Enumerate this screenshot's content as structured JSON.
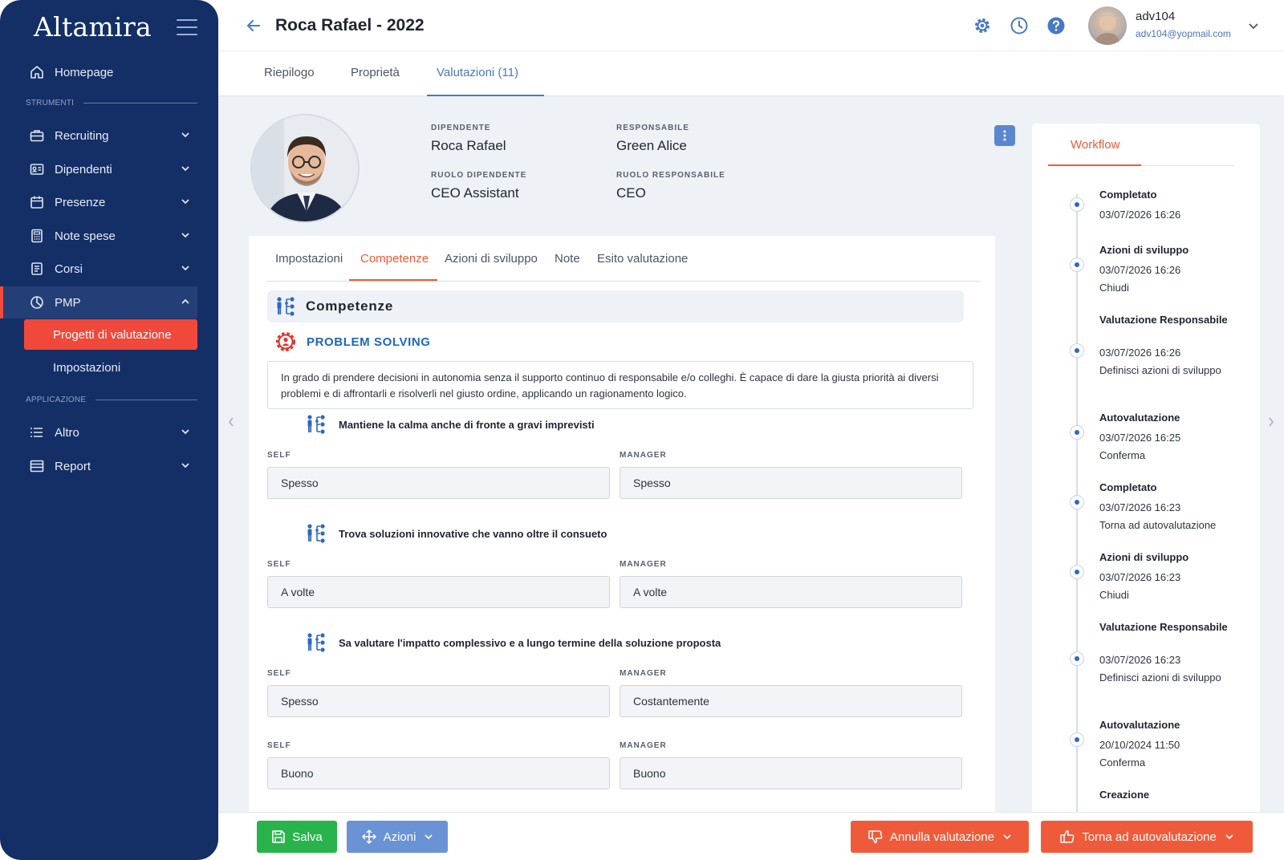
{
  "sidebar": {
    "logo": "Altamira",
    "homepage": "Homepage",
    "section_tools": "STRUMENTI",
    "items": [
      {
        "label": "Recruiting"
      },
      {
        "label": "Dipendenti"
      },
      {
        "label": "Presenze"
      },
      {
        "label": "Note spese"
      },
      {
        "label": "Corsi"
      },
      {
        "label": "PMP"
      }
    ],
    "pmp_sub": [
      {
        "label": "Progetti di valutazione"
      },
      {
        "label": "Impostazioni"
      }
    ],
    "section_app": "APPLICAZIONE",
    "app_items": [
      {
        "label": "Altro"
      },
      {
        "label": "Report"
      }
    ]
  },
  "header": {
    "title": "Roca Rafael - 2022",
    "user_name": "adv104",
    "user_email": "adv104@yopmail.com"
  },
  "top_tabs": [
    "Riepilogo",
    "Proprietà",
    "Valutazioni (11)"
  ],
  "employee": {
    "label_employee": "DIPENDENTE",
    "employee": "Roca Rafael",
    "label_manager": "RESPONSABILE",
    "manager": "Green Alice",
    "label_employee_role": "RUOLO DIPENDENTE",
    "employee_role": "CEO Assistant",
    "label_manager_role": "RUOLO RESPONSABILE",
    "manager_role": "CEO"
  },
  "panel_tabs": [
    "Impostazioni",
    "Competenze",
    "Azioni di sviluppo",
    "Note",
    "Esito valutazione"
  ],
  "section": {
    "title": "Competenze",
    "competence_name": "PROBLEM SOLVING",
    "description": "In grado di prendere decisioni in autonomia senza il supporto continuo di responsabile e/o colleghi. È capace di dare la giusta priorità ai diversi problemi e di affrontarli e risolverli nel giusto ordine, applicando un ragionamento logico."
  },
  "labels": {
    "self": "SELF",
    "manager": "MANAGER"
  },
  "questions": [
    {
      "text": "Mantiene la calma anche di fronte a gravi imprevisti",
      "self": "Spesso",
      "manager": "Spesso"
    },
    {
      "text": "Trova soluzioni innovative che vanno oltre il consueto",
      "self": "A volte",
      "manager": "A volte"
    },
    {
      "text": "Sa valutare l'impatto complessivo e a lungo termine della soluzione proposta",
      "self": "Spesso",
      "manager": "Costantemente"
    }
  ],
  "overall": {
    "self": "Buono",
    "manager": "Buono"
  },
  "workflow": {
    "tab": "Workflow",
    "steps": [
      {
        "title": "Completato",
        "date": "03/07/2026 16:26",
        "action": ""
      },
      {
        "title": "Azioni di sviluppo",
        "date": "03/07/2026 16:26",
        "action": "Chiudi"
      },
      {
        "title": "Valutazione Responsabile",
        "date": "03/07/2026 16:26",
        "action": "Definisci azioni di sviluppo"
      },
      {
        "title": "Autovalutazione",
        "date": "03/07/2026 16:25",
        "action": "Conferma"
      },
      {
        "title": "Completato",
        "date": "03/07/2026 16:23",
        "action": "Torna ad autovalutazione"
      },
      {
        "title": "Azioni di sviluppo",
        "date": "03/07/2026 16:23",
        "action": "Chiudi"
      },
      {
        "title": "Valutazione Responsabile",
        "date": "03/07/2026 16:23",
        "action": "Definisci azioni di sviluppo"
      },
      {
        "title": "Autovalutazione",
        "date": "20/10/2024 11:50",
        "action": "Conferma"
      },
      {
        "title": "Creazione",
        "date": "",
        "action": ""
      }
    ]
  },
  "buttons": {
    "save": "Salva",
    "actions": "Azioni",
    "cancel_evaluation": "Annulla valutazione",
    "back_to_self": "Torna ad autovalutazione"
  },
  "colors": {
    "sidebar_bg": "#132f66",
    "accent_red": "#f0483a",
    "accent_orange": "#ee5b35",
    "accent_blue": "#4878c6",
    "save_green": "#28b44b",
    "actions_blue": "#6a93d6"
  }
}
